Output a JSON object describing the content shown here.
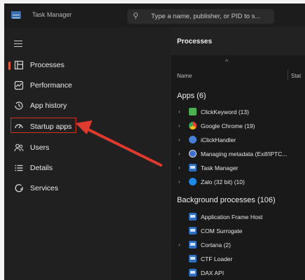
{
  "window": {
    "title": "Task Manager",
    "search": {
      "placeholder": "Type a name, publisher, or PID to s..."
    }
  },
  "sidebar": {
    "items": [
      {
        "label": "Processes",
        "icon": "processes-icon",
        "active": true
      },
      {
        "label": "Performance",
        "icon": "performance-icon"
      },
      {
        "label": "App history",
        "icon": "history-icon"
      },
      {
        "label": "Startup apps",
        "icon": "startup-icon"
      },
      {
        "label": "Users",
        "icon": "users-icon"
      },
      {
        "label": "Details",
        "icon": "details-icon"
      },
      {
        "label": "Services",
        "icon": "services-icon"
      }
    ]
  },
  "main": {
    "title": "Processes",
    "columns": {
      "name": "Name",
      "status": "Stat"
    },
    "apps_heading": "Apps (6)",
    "apps": [
      {
        "label": "ClickKeyword (13)",
        "icon": "clickkeyword-icon",
        "color": "#4caf50"
      },
      {
        "label": "Google Chrome (19)",
        "icon": "chrome-icon",
        "color": "#e8453c"
      },
      {
        "label": "iClickHandler",
        "icon": "iclickhandler-icon",
        "color": "#4a7fd8"
      },
      {
        "label": "Managing metadata (Exif/IPTC...",
        "icon": "metadata-icon",
        "color": "#3b6fd6"
      },
      {
        "label": "Task Manager",
        "icon": "task-manager-icon",
        "color": "#2f6fc0"
      },
      {
        "label": "Zalo (32 bit) (10)",
        "icon": "zalo-icon",
        "color": "#1e88e5"
      }
    ],
    "background_heading": "Background processes (106)",
    "background": [
      {
        "label": "Application Frame Host",
        "expandable": false
      },
      {
        "label": "COM Surrogate",
        "expandable": false
      },
      {
        "label": "Cortana (2)",
        "expandable": true
      },
      {
        "label": "CTF Loader",
        "expandable": false
      },
      {
        "label": "DAX API",
        "expandable": false
      }
    ]
  },
  "colors": {
    "accent": "#e55a3b",
    "annotation": "#d8301f"
  }
}
